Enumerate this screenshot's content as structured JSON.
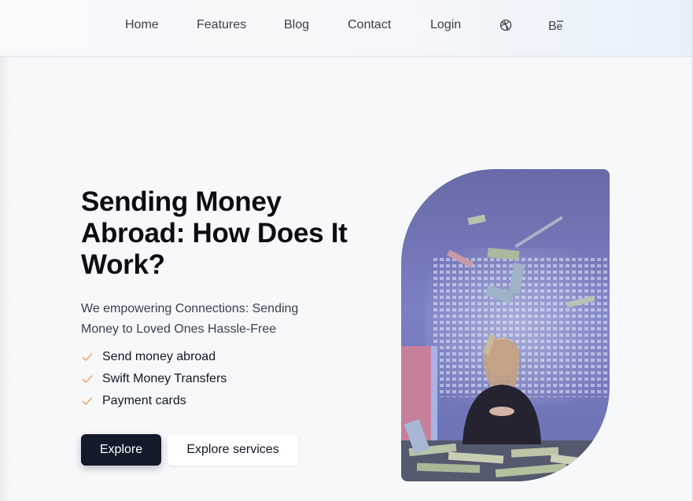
{
  "nav": {
    "items": [
      "Home",
      "Features",
      "Blog",
      "Contact",
      "Login"
    ],
    "icons": [
      "dribbble-icon",
      "behance-icon"
    ]
  },
  "hero": {
    "title": "Sending Money Abroad: How Does It Work?",
    "subtitle": "We empowering Connections: Sending Money to Loved Ones Hassle-Free",
    "features": [
      "Send money abroad",
      "Swift Money Transfers",
      "Payment cards"
    ],
    "primary_button": "Explore",
    "secondary_button": "Explore services",
    "image": "woman-at-desk-with-falling-money"
  },
  "colors": {
    "accent_check": "#f0a76b",
    "button_dark": "#131a2a",
    "image_tint": "#6f74b8"
  }
}
